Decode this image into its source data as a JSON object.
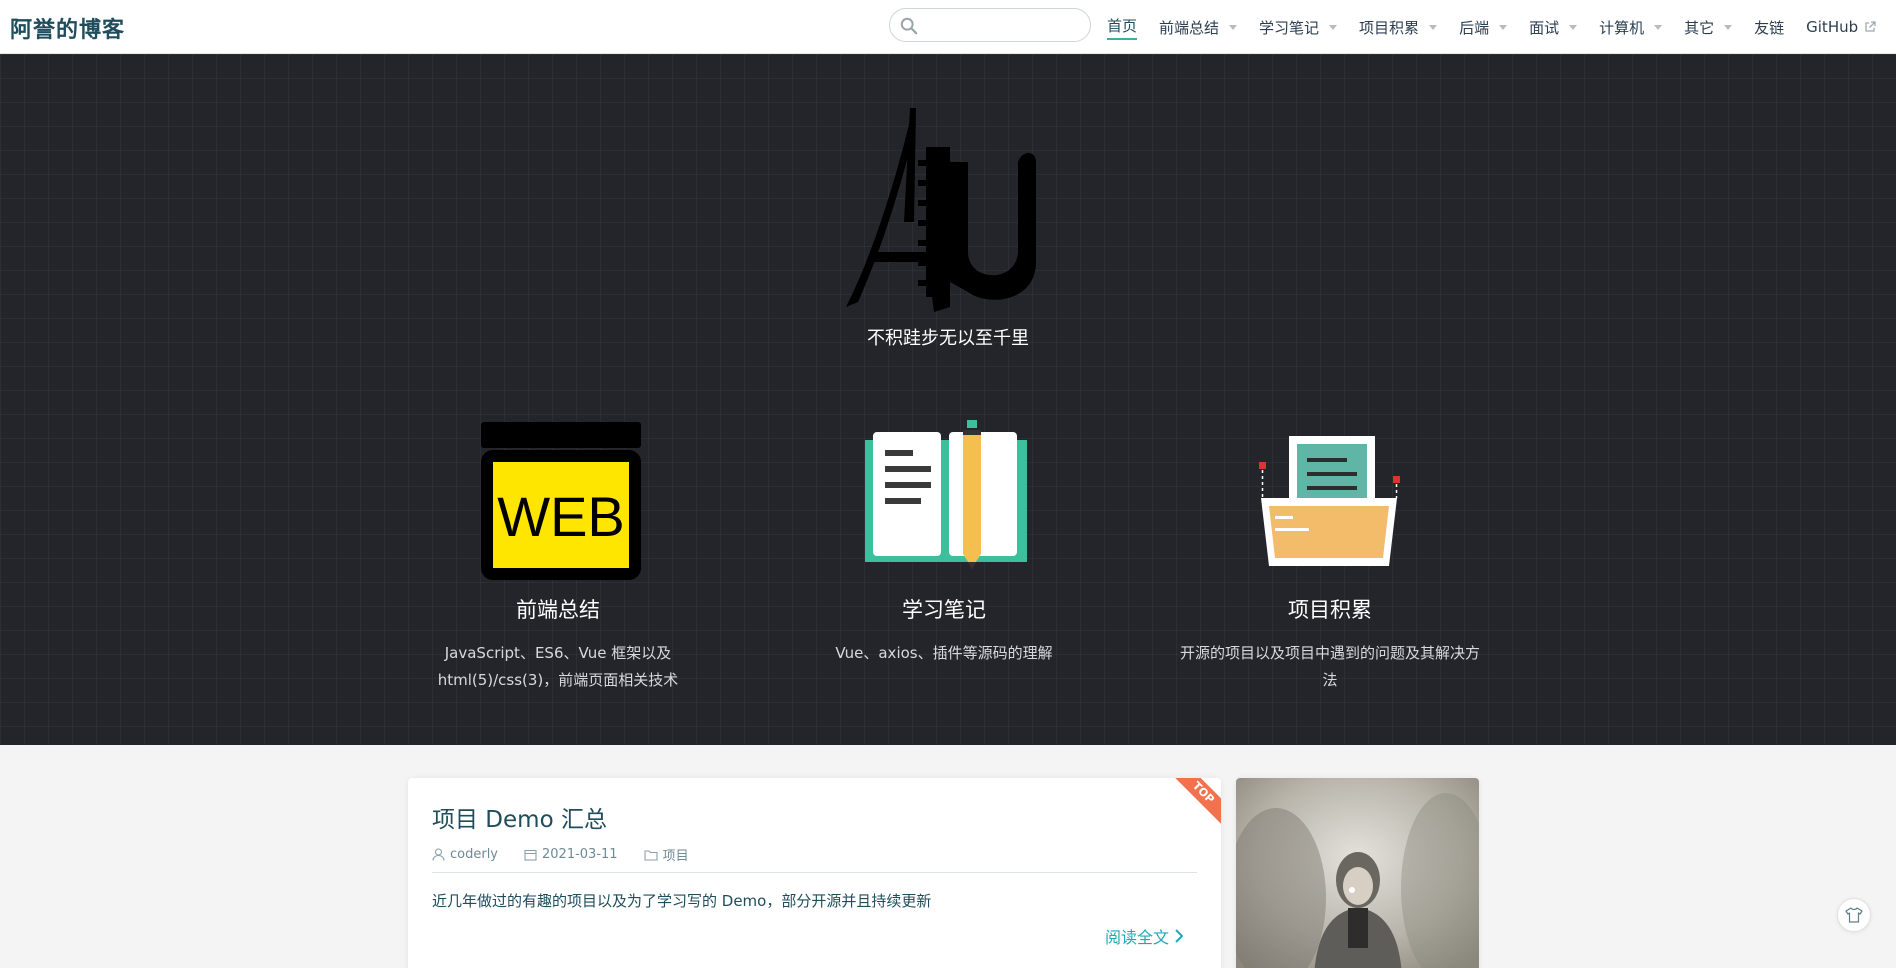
{
  "navbar": {
    "brand": "阿誉的博客",
    "search_placeholder": "",
    "items": [
      {
        "label": "首页",
        "active": true,
        "dropdown": false
      },
      {
        "label": "前端总结",
        "dropdown": true
      },
      {
        "label": "学习笔记",
        "dropdown": true
      },
      {
        "label": "项目积累",
        "dropdown": true
      },
      {
        "label": "后端",
        "dropdown": true
      },
      {
        "label": "面试",
        "dropdown": true
      },
      {
        "label": "计算机",
        "dropdown": true
      },
      {
        "label": "其它",
        "dropdown": true
      },
      {
        "label": "友链",
        "dropdown": false
      },
      {
        "label": "GitHub",
        "dropdown": false,
        "external": true
      }
    ]
  },
  "hero": {
    "logo_icon": "au-logo",
    "tagline": "不积跬步无以至千里",
    "features": [
      {
        "icon": "web-icon",
        "icon_text": "WEB",
        "title": "前端总结",
        "description": "JavaScript、ES6、Vue 框架以及 html(5)/css(3)，前端页面相关技术"
      },
      {
        "icon": "book-icon",
        "title": "学习笔记",
        "description": "Vue、axios、插件等源码的理解"
      },
      {
        "icon": "folder-icon",
        "title": "项目积累",
        "description": "开源的项目以及项目中遇到的问题及其解决方法"
      }
    ]
  },
  "post": {
    "badge": "TOP",
    "title": "项目 Demo 汇总",
    "author": "coderly",
    "date": "2021-03-11",
    "category": "项目",
    "excerpt": "近几年做过的有趣的项目以及为了学习写的 Demo，部分开源并且持续更新",
    "read_more": "阅读全文"
  },
  "colors": {
    "accent": "#3eaf9c",
    "link": "#1eaab4",
    "hero_bg": "#24242b",
    "ribbon": "#f2714f",
    "brand": "#1f4d5c"
  }
}
